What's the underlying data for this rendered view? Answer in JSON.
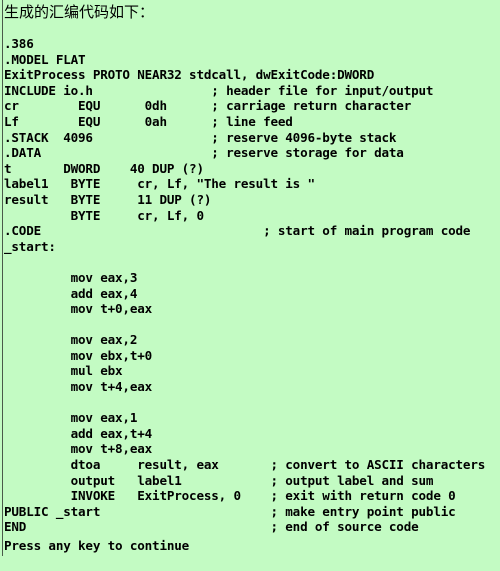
{
  "header": {
    "title": "生成的汇编代码如下："
  },
  "colors": {
    "background": "#c3fbc3",
    "text": "#000000",
    "rule": "#4a5a4a"
  },
  "code": {
    "language": "x86-assembly",
    "lines": [
      ".386",
      ".MODEL FLAT",
      "ExitProcess PROTO NEAR32 stdcall, dwExitCode:DWORD",
      "INCLUDE io.h                ; header file for input/output",
      "cr        EQU      0dh      ; carriage return character",
      "Lf        EQU      0ah      ; line feed",
      ".STACK  4096                ; reserve 4096-byte stack",
      ".DATA                       ; reserve storage for data",
      "t       DWORD    40 DUP (?)",
      "label1   BYTE     cr, Lf, \"The result is \"",
      "result   BYTE     11 DUP (?)",
      "         BYTE     cr, Lf, 0",
      ".CODE                              ; start of main program code",
      "_start:",
      "",
      "         mov eax,3",
      "         add eax,4",
      "         mov t+0,eax",
      "",
      "         mov eax,2",
      "         mov ebx,t+0",
      "         mul ebx",
      "         mov t+4,eax",
      "",
      "         mov eax,1",
      "         add eax,t+4",
      "         mov t+8,eax",
      "         dtoa     result, eax       ; convert to ASCII characters",
      "         output   label1            ; output label and sum",
      "         INVOKE   ExitProcess, 0    ; exit with return code 0",
      "PUBLIC _start                       ; make entry point public",
      "END                                 ; end of source code"
    ]
  },
  "footer": {
    "prompt": "Press any key to continue"
  }
}
